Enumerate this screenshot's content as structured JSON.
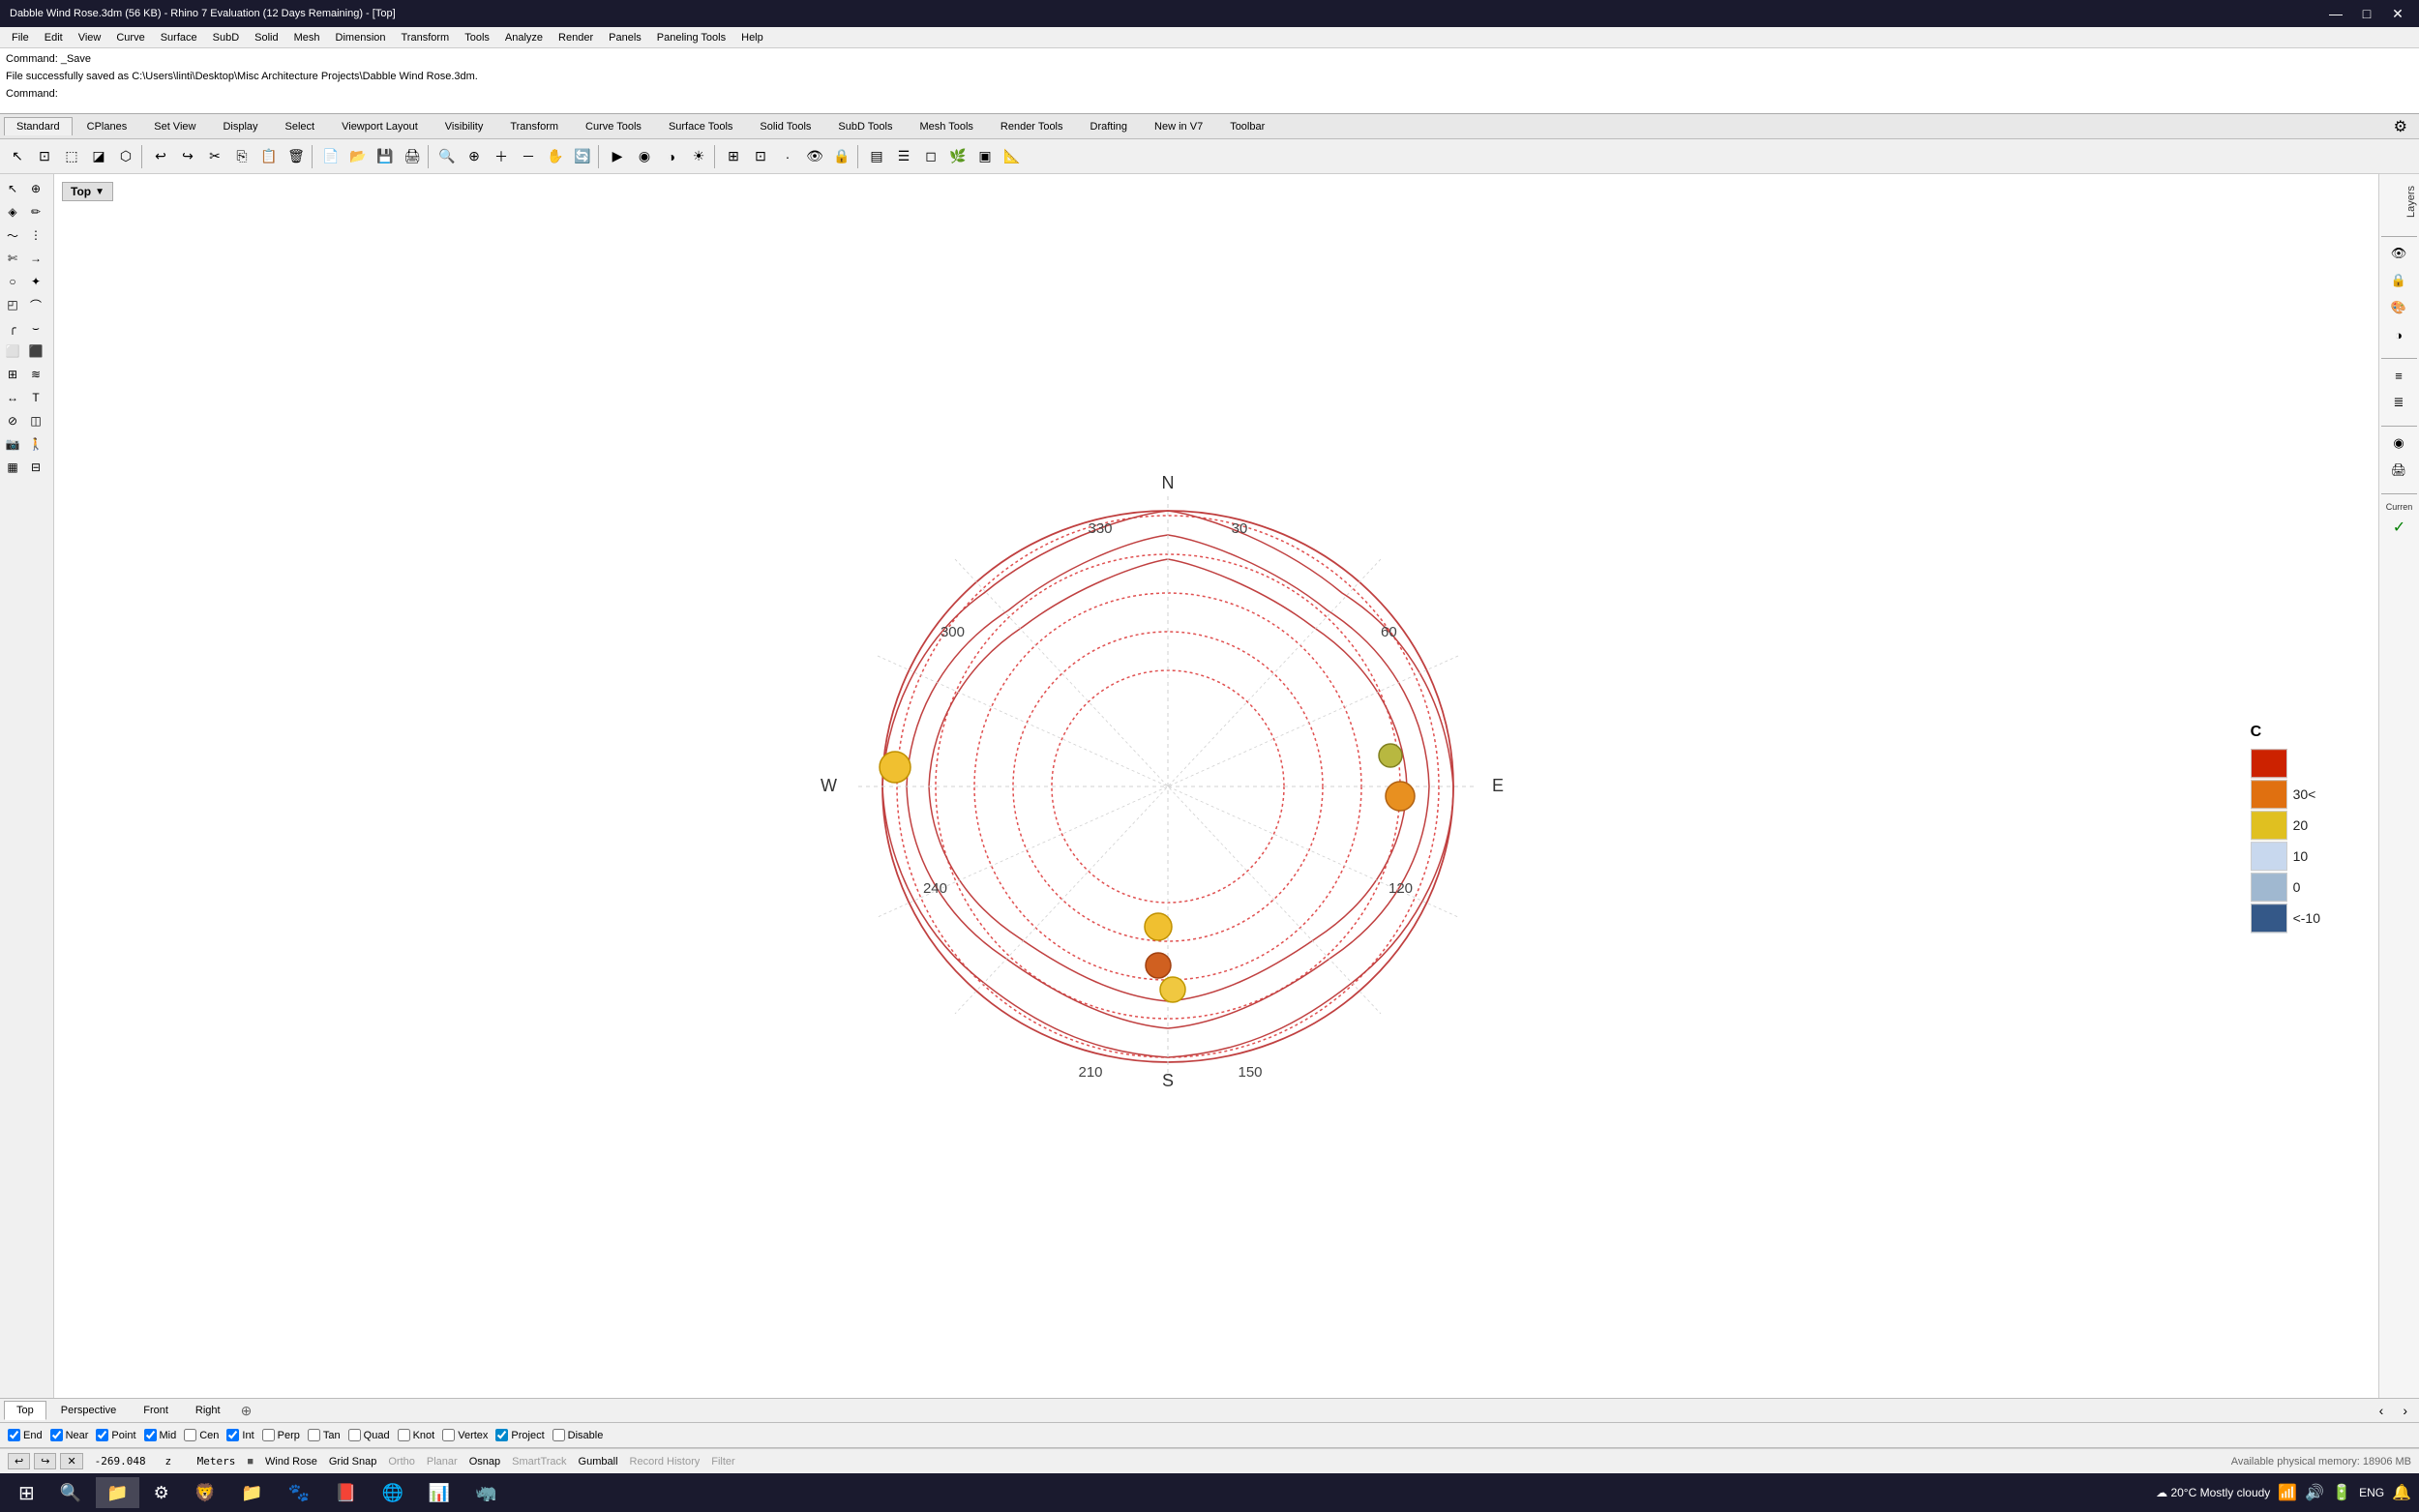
{
  "titleBar": {
    "title": "Dabble Wind Rose.3dm (56 KB) - Rhino 7 Evaluation (12 Days Remaining) - [Top]",
    "minimize": "—",
    "maximize": "□",
    "close": "✕"
  },
  "menuBar": {
    "items": [
      "File",
      "Edit",
      "View",
      "Curve",
      "Surface",
      "SubD",
      "Solid",
      "Mesh",
      "Dimension",
      "Transform",
      "Tools",
      "Analyze",
      "Render",
      "Panels",
      "Paneling Tools",
      "Help"
    ]
  },
  "commandArea": {
    "line1": "Command: _Save",
    "line2": "File successfully saved as C:\\Users\\linti\\Desktop\\Misc Architecture Projects\\Dabble Wind Rose.3dm.",
    "prompt": "Command:"
  },
  "toolbarTabs": {
    "items": [
      "Standard",
      "CPlanes",
      "Set View",
      "Display",
      "Select",
      "Viewport Layout",
      "Visibility",
      "Transform",
      "Curve Tools",
      "Surface Tools",
      "Solid Tools",
      "SubD Tools",
      "Mesh Tools",
      "Render Tools",
      "Drafting",
      "New in V7",
      "Toolbar"
    ],
    "settings_icon": "⚙"
  },
  "viewportLabel": {
    "text": "Top",
    "arrow": "▼"
  },
  "compassLabels": {
    "N": "N",
    "S": "S",
    "E": "E",
    "W": "W",
    "deg330": "330",
    "deg300": "300",
    "deg240": "240",
    "deg210": "210",
    "deg150": "150",
    "deg120": "120",
    "deg60": "60",
    "deg30": "30"
  },
  "legend": {
    "title": "C",
    "items": [
      {
        "label": "30<",
        "color": "#e84c0e"
      },
      {
        "label": "20",
        "color": "#f5a623"
      },
      {
        "label": "10",
        "color": "#f5d76e"
      },
      {
        "label": "0",
        "color": "#b8cce4"
      },
      {
        "label": "<-10",
        "color": "#3a5a8a"
      }
    ]
  },
  "viewTabs": {
    "items": [
      "Top",
      "Perspective",
      "Front",
      "Right"
    ],
    "active": "Top",
    "add": "+"
  },
  "snapBar": {
    "snaps": [
      {
        "label": "End",
        "checked": true
      },
      {
        "label": "Near",
        "checked": true
      },
      {
        "label": "Point",
        "checked": true
      },
      {
        "label": "Mid",
        "checked": true
      },
      {
        "label": "Cen",
        "checked": false
      },
      {
        "label": "Int",
        "checked": true
      },
      {
        "label": "Perp",
        "checked": false
      },
      {
        "label": "Tan",
        "checked": false
      },
      {
        "label": "Quad",
        "checked": false
      },
      {
        "label": "Knot",
        "checked": false
      },
      {
        "label": "Vertex",
        "checked": false
      },
      {
        "label": "Project",
        "checked": true
      },
      {
        "label": "Disable",
        "checked": false
      }
    ]
  },
  "statusBar": {
    "undo": "↩",
    "redo": "↪",
    "stop": "✕",
    "coords": "-269.048",
    "z_label": "z",
    "units": "Meters",
    "layer_dot": "■",
    "layer_name": "Wind Rose",
    "grid_snap": "Grid Snap",
    "ortho": "Ortho",
    "planar": "Planar",
    "osnap": "Osnap",
    "smarttrack": "SmartTrack",
    "gumball": "Gumball",
    "record_history": "Record History",
    "filter": "Filter",
    "memory": "Available physical memory: 18906 MB"
  },
  "taskbar": {
    "start_icon": "⊞",
    "weather": "20°C  Mostly cloudy",
    "time": "ENG",
    "apps": [
      "⊞",
      "🔍",
      "📁",
      "⚙",
      "🦁",
      "📁",
      "🐾",
      "🔴",
      "📊",
      "🐺"
    ]
  }
}
